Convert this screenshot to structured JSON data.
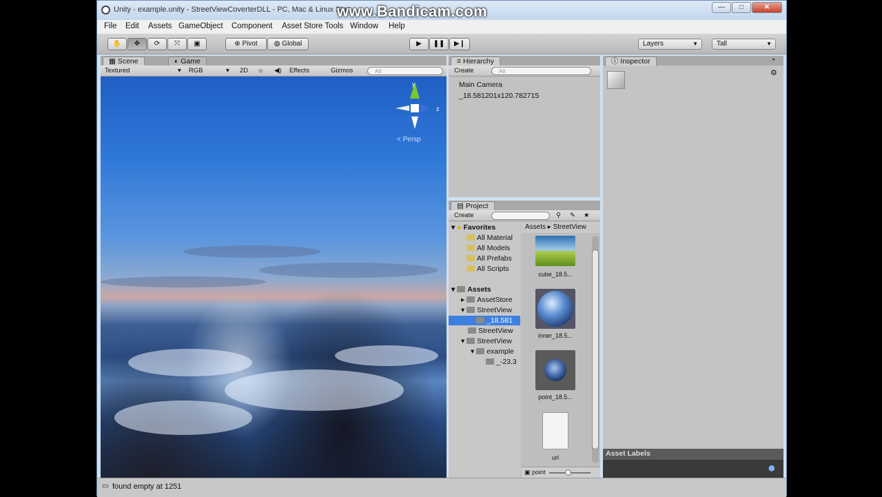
{
  "window": {
    "title": "Unity - example.unity - StreetViewCoverterDLL - PC, Mac & Linux Stan",
    "watermark": "www.Bandicam.com",
    "minimize": "—",
    "maximize": "□",
    "close": "✕"
  },
  "menu": [
    "File",
    "Edit",
    "Assets",
    "GameObject",
    "Component",
    "Asset Store Tools",
    "Window",
    "Help"
  ],
  "toolbar": {
    "pivot": "Pivot",
    "global": "Global",
    "layers": "Layers",
    "layout": "Tall"
  },
  "scene": {
    "tab_scene": "Scene",
    "tab_game": "Game",
    "shading": "Textured",
    "render_mode": "RGB",
    "mode_2d": "2D",
    "effects": "Effects",
    "gizmos": "Gizmos",
    "search_placeholder": "All",
    "gizmo_y": "y",
    "gizmo_z": "z",
    "projection": "Persp"
  },
  "hierarchy": {
    "tab": "Hierarchy",
    "create": "Create",
    "search_placeholder": "All",
    "items": [
      "Main Camera",
      "_18.581201x120.782715"
    ]
  },
  "project": {
    "tab": "Project",
    "create": "Create",
    "favorites_label": "Favorites",
    "favorites": [
      "All Material",
      "All Models",
      "All Prefabs",
      "All Scripts"
    ],
    "assets_label": "Assets",
    "tree": [
      {
        "label": "AssetStore",
        "depth": 1
      },
      {
        "label": "StreetView",
        "depth": 1
      },
      {
        "label": "_18.581",
        "depth": 2,
        "selected": true
      },
      {
        "label": "StreetView",
        "depth": 1
      },
      {
        "label": "StreetView",
        "depth": 1
      },
      {
        "label": "example",
        "depth": 2
      },
      {
        "label": "_-23.3",
        "depth": 3
      }
    ],
    "breadcrumb": [
      "Assets",
      "StreetView"
    ],
    "assets": [
      {
        "label": "cube_18.5...",
        "icon": "cube-texture-icon"
      },
      {
        "label": "inner_18.5...",
        "icon": "sphere-texture-icon"
      },
      {
        "label": "point_18.5...",
        "icon": "sphere-dark-icon"
      },
      {
        "label": "url",
        "icon": "text-document-icon"
      }
    ],
    "search_text": "point",
    "slider_value": 0.45
  },
  "inspector": {
    "tab": "Inspector",
    "asset_labels": "Asset Labels"
  },
  "status": {
    "message": "found empty at 1251"
  }
}
